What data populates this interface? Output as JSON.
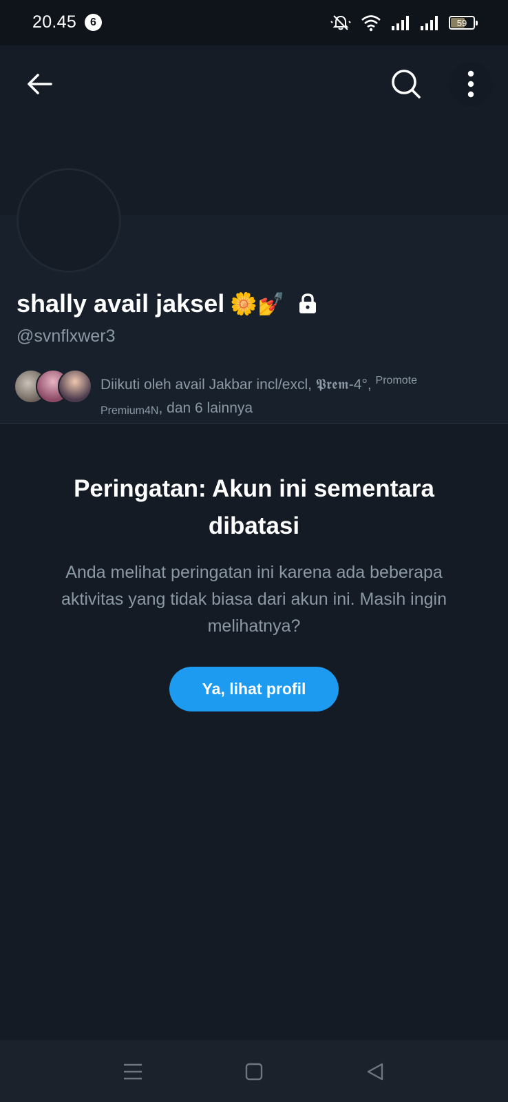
{
  "status_bar": {
    "time": "20.45",
    "notification_count": "6",
    "battery_level": "59",
    "battery_fraction": 0.59
  },
  "profile": {
    "display_name": "shally avail jaksel",
    "name_emojis": "🌼💅",
    "handle": "@svnflxwer3",
    "followed_by": {
      "prefix": "Diikuti oleh avail Jakbar incl/excl, 𝕻𝖗𝖊𝖒-4°, ",
      "sup_text": "Promote",
      "line2_sub": "Premium4N",
      "suffix": ", dan 6 lainnya"
    }
  },
  "warning": {
    "title": "Peringatan: Akun ini sementara dibatasi",
    "body": "Anda melihat peringatan ini karena ada beberapa aktivitas yang tidak biasa dari akun ini. Masih ingin melihatnya?",
    "button_label": "Ya, lihat profil"
  },
  "colors": {
    "accent": "#1d9bf0",
    "background": "#141b24",
    "secondary_text": "#8b98a5"
  },
  "icons": {
    "back": "arrow-left-icon",
    "search": "search-icon",
    "more": "more-vertical-icon",
    "lock": "lock-icon",
    "nav_menu": "menu-icon",
    "nav_home": "square-home-icon",
    "nav_back": "triangle-back-icon"
  }
}
